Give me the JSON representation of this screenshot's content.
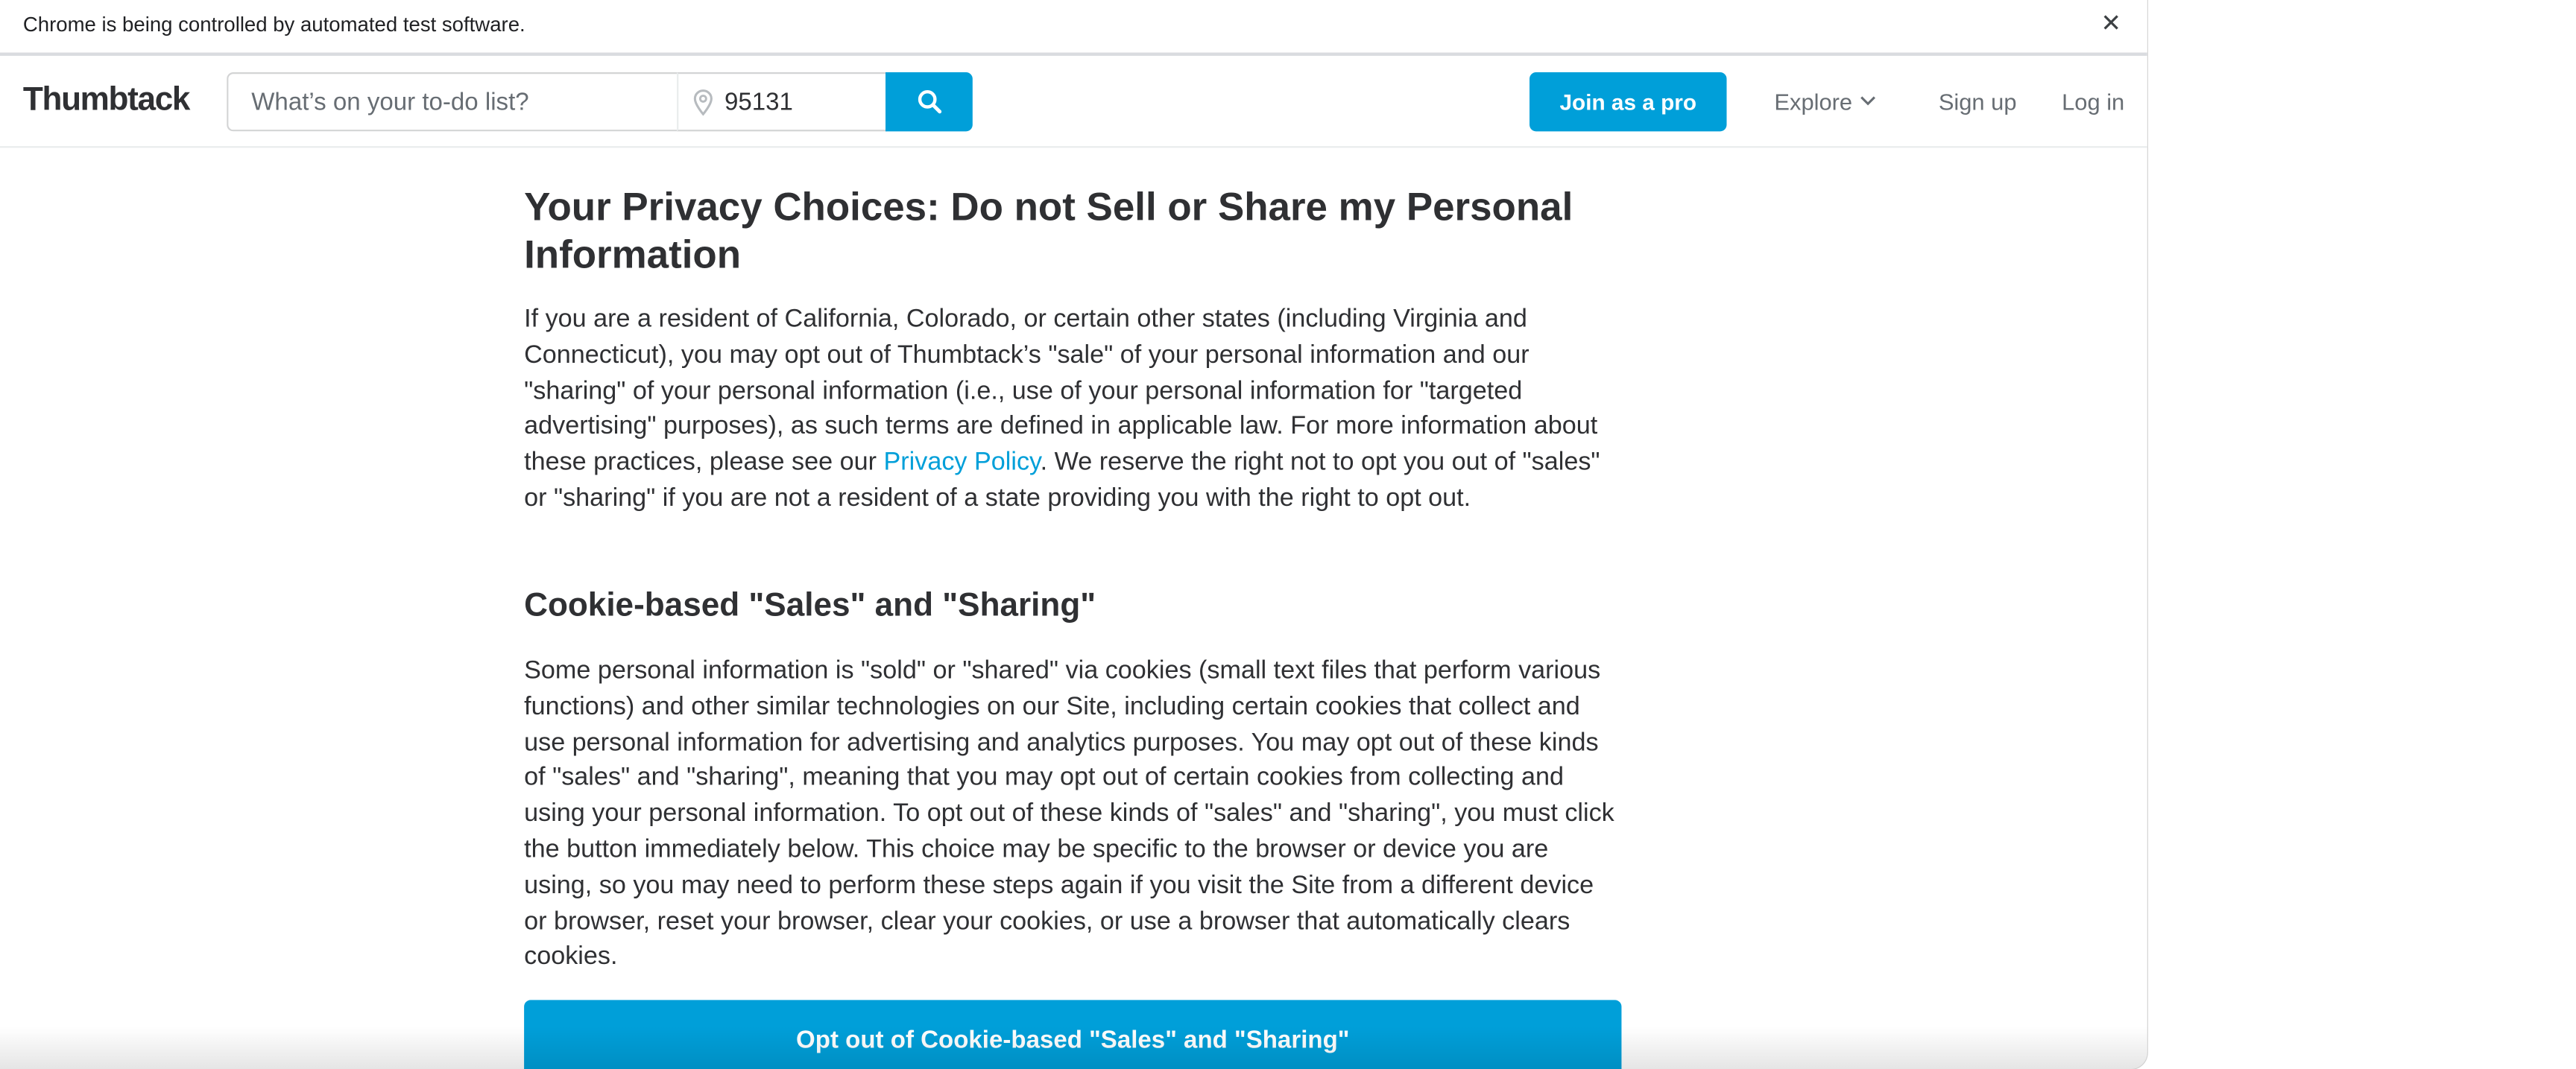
{
  "infobar": {
    "message": "Chrome is being controlled by automated test software.",
    "close_glyph": "✕"
  },
  "header": {
    "logo": "Thumbtack",
    "search": {
      "placeholder": "What’s on your to-do list?"
    },
    "zip": {
      "value": "95131"
    },
    "join_label": "Join as a pro",
    "explore_label": "Explore",
    "signup_label": "Sign up",
    "login_label": "Log in"
  },
  "main": {
    "title": "Your Privacy Choices: Do not Sell or Share my Personal Information",
    "intro_part1": "If you are a resident of California, Colorado, or certain other states (including Virginia and Connecticut), you may opt out of Thumbtack’s \"sale\" of your personal information and our \"sharing\" of your personal information (i.e., use of your personal information for \"targeted advertising\" purposes), as such terms are defined in applicable law. For more information about these practices, please see our ",
    "privacy_link": "Privacy Policy",
    "intro_part2": ". We reserve the right not to opt you out of \"sales\" or \"sharing\" if you are not a resident of a state providing you with the right to opt out.",
    "section_title": "Cookie-based \"Sales\" and \"Sharing\"",
    "section_body": "Some personal information is \"sold\" or \"shared\" via cookies (small text files that perform various functions) and other similar technologies on our Site, including certain cookies that collect and use personal information for advertising and analytics purposes. You may opt out of these kinds of \"sales\" and \"sharing\", meaning that you may opt out of certain cookies from collecting and using your personal information. To opt out of these kinds of \"sales\" and \"sharing\", you must click the button immediately below. This choice may be specific to the browser or device you are using, so you may need to perform these steps again if you visit the Site from a different device or browser, reset your browser, clear your cookies, or use a browser that automatically clears cookies.",
    "opt_out_label": "Opt out of Cookie-based \"Sales\" and \"Sharing\""
  },
  "colors": {
    "accent": "#009fd9",
    "text": "#2f3033",
    "muted": "#676d73"
  },
  "icons": [
    "close-icon",
    "location-pin-icon",
    "search-icon",
    "chevron-down-icon"
  ]
}
